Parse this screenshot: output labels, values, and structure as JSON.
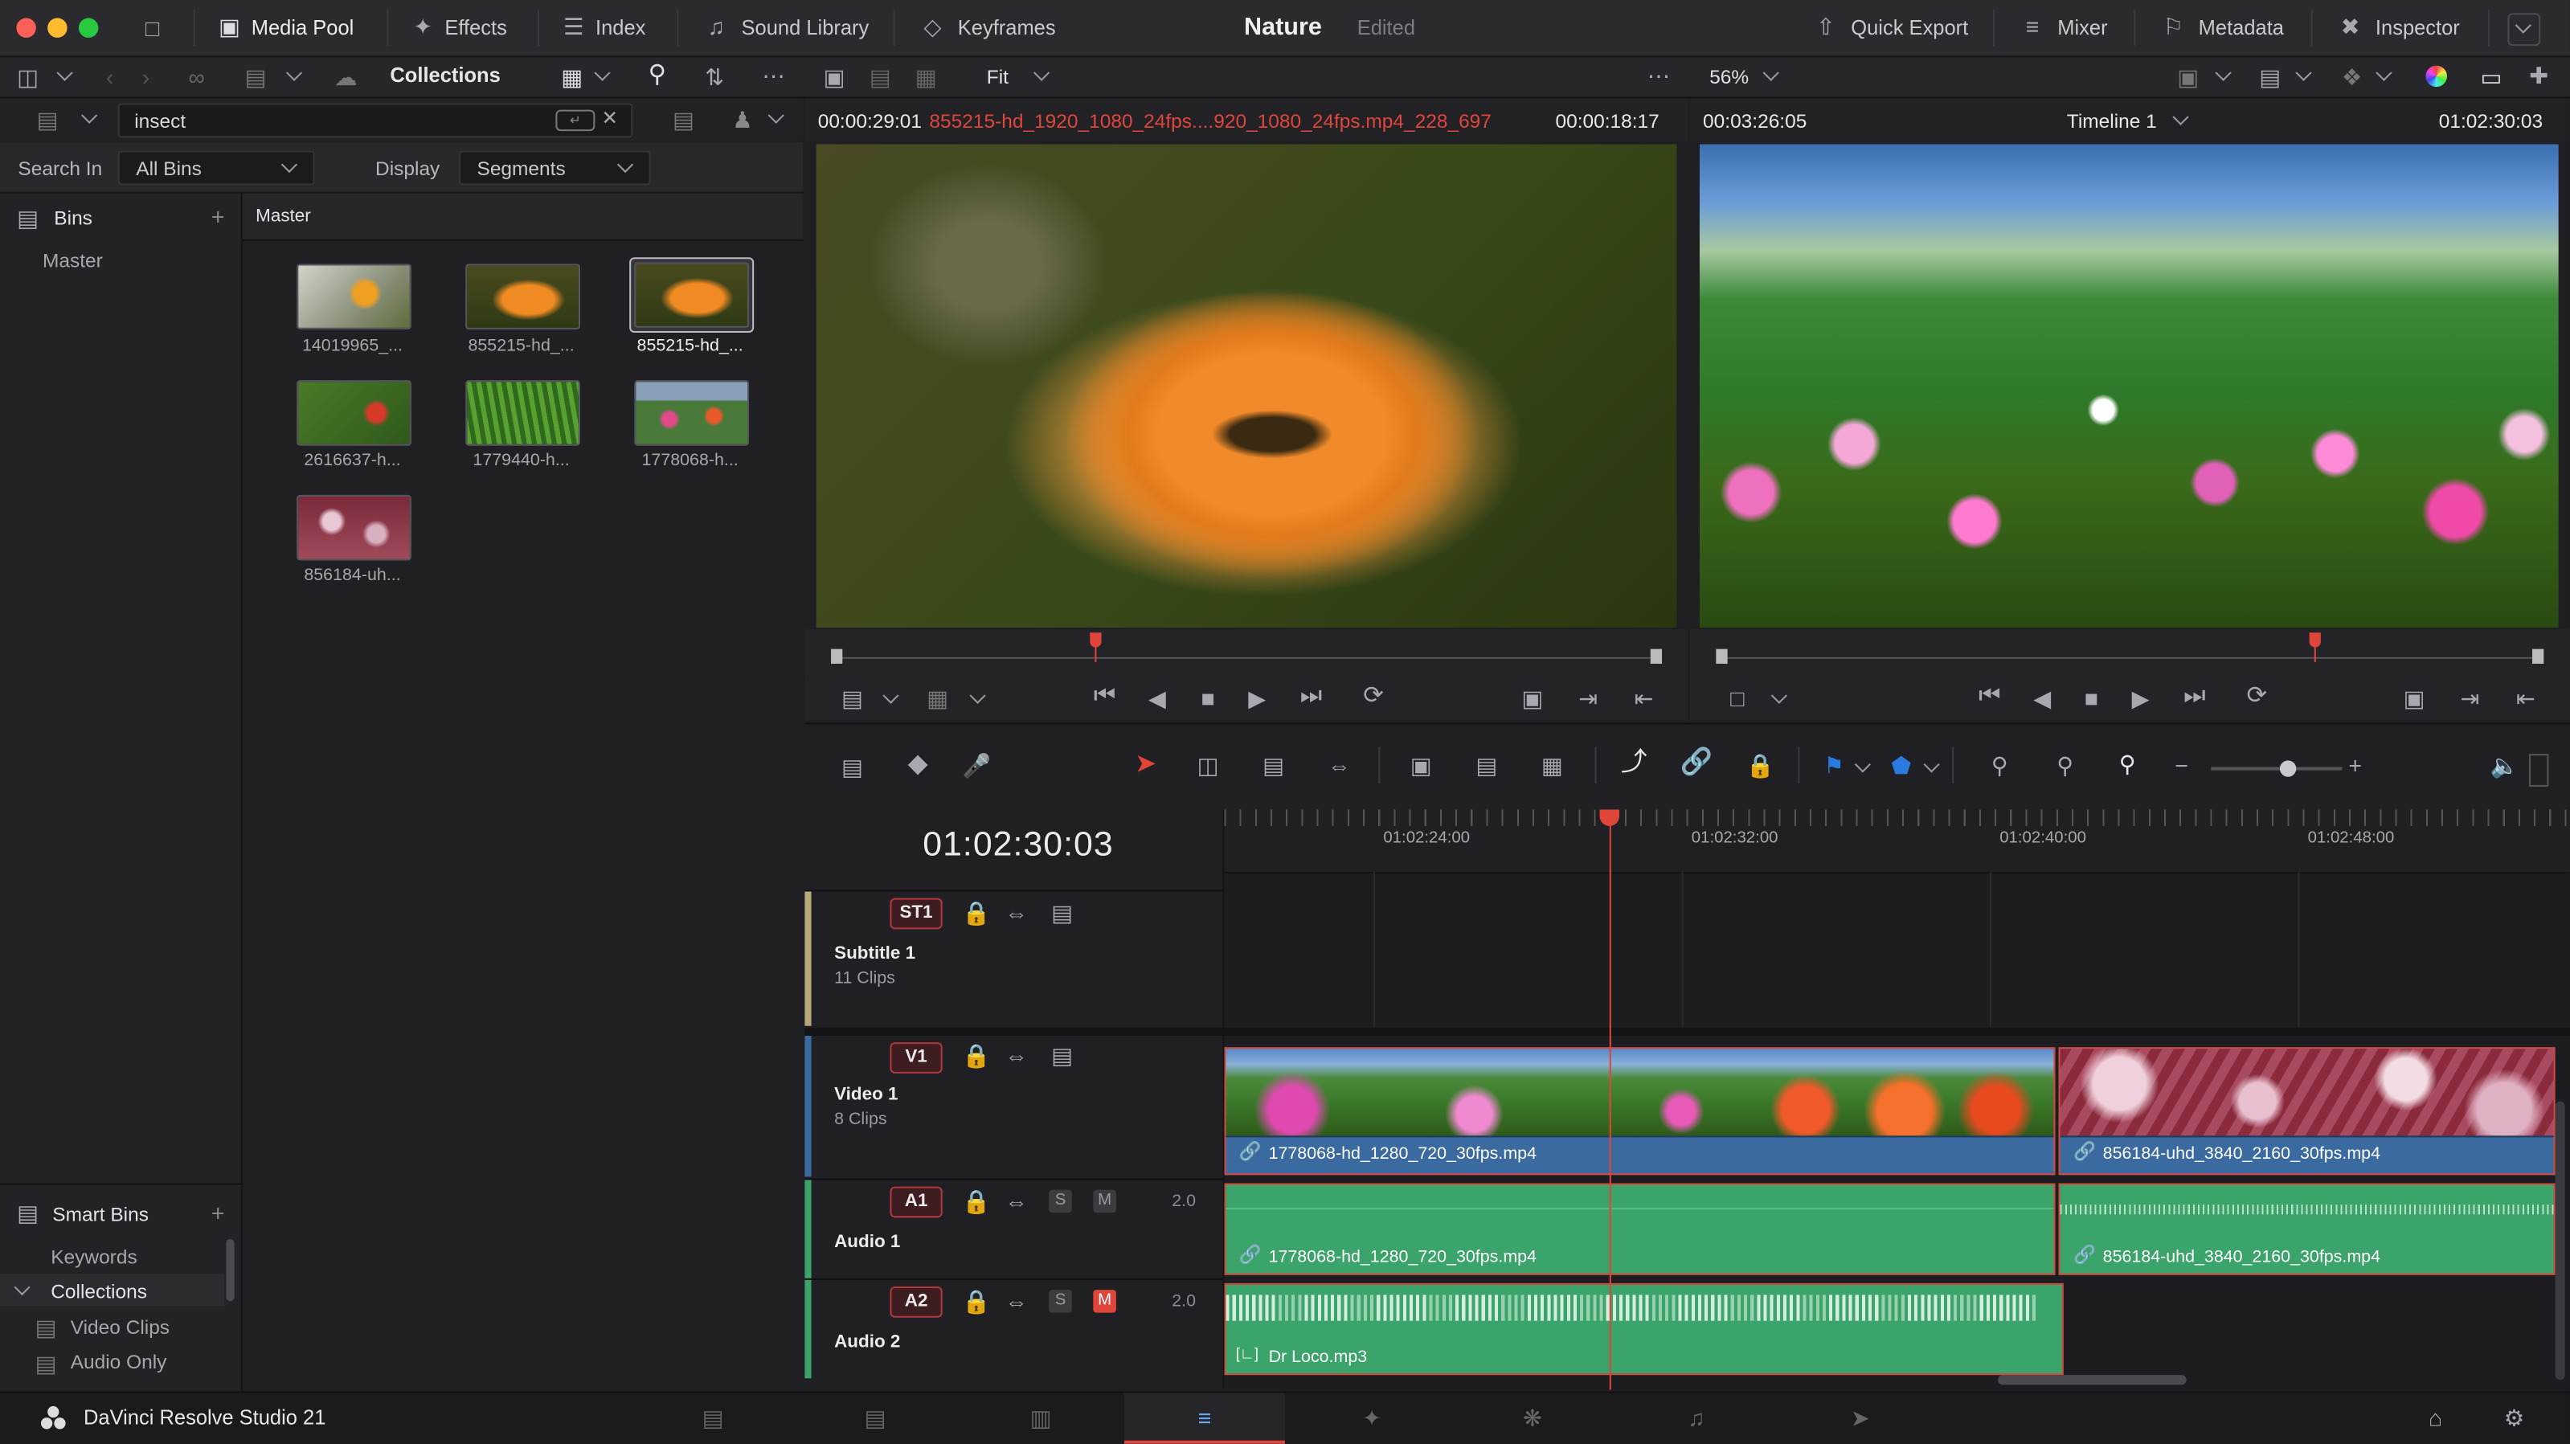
{
  "window": {
    "project": "Nature",
    "status": "Edited"
  },
  "toolbar": {
    "media_pool": "Media Pool",
    "effects": "Effects",
    "index": "Index",
    "sound_library": "Sound Library",
    "keyframes": "Keyframes",
    "quick_export": "Quick Export",
    "mixer": "Mixer",
    "metadata": "Metadata",
    "inspector": "Inspector"
  },
  "subbar": {
    "collections": "Collections",
    "fit": "Fit",
    "zoom": "56%"
  },
  "search": {
    "query": "insect",
    "search_in_label": "Search In",
    "search_in_value": "All Bins",
    "display_label": "Display",
    "display_value": "Segments"
  },
  "bins": {
    "header": "Bins",
    "master": "Master",
    "smart_header": "Smart Bins",
    "keywords": "Keywords",
    "collections": "Collections",
    "video_clips": "Video Clips",
    "audio_only": "Audio Only"
  },
  "pool": {
    "title": "Master",
    "clips": [
      {
        "label": "14019965_..."
      },
      {
        "label": "855215-hd_..."
      },
      {
        "label": "855215-hd_..."
      },
      {
        "label": "2616637-h..."
      },
      {
        "label": "1779440-h..."
      },
      {
        "label": "1778068-h..."
      },
      {
        "label": "856184-uh..."
      }
    ]
  },
  "source": {
    "tc_in": "00:00:29:01",
    "clip": "855215-hd_1920_1080_24fps....920_1080_24fps.mp4_228_697",
    "duration": "00:00:18:17"
  },
  "timeline_view": {
    "tc_left": "00:03:26:05",
    "name": "Timeline 1",
    "tc_right": "01:02:30:03"
  },
  "timeline": {
    "timecode": "01:02:30:03",
    "ruler": [
      "01:02:24:00",
      "01:02:32:00",
      "01:02:40:00",
      "01:02:48:00"
    ],
    "tracks": {
      "st1": {
        "badge": "ST1",
        "name": "Subtitle 1",
        "count": "11 Clips"
      },
      "v1": {
        "badge": "V1",
        "name": "Video 1",
        "count": "8 Clips"
      },
      "a1": {
        "badge": "A1",
        "name": "Audio 1",
        "level": "2.0",
        "s": "S",
        "m": "M"
      },
      "a2": {
        "badge": "A2",
        "name": "Audio 2",
        "level": "2.0",
        "s": "S",
        "m": "M"
      }
    },
    "clips": {
      "v1a": "1778068-hd_1280_720_30fps.mp4",
      "v1b": "856184-uhd_3840_2160_30fps.mp4",
      "a1a": "1778068-hd_1280_720_30fps.mp4",
      "a1b": "856184-uhd_3840_2160_30fps.mp4",
      "a2a": "Dr Loco.mp3"
    }
  },
  "app": {
    "name": "DaVinci Resolve Studio 21"
  },
  "colors": {
    "accent_red": "#e04a3c",
    "video_clip": "#3a6aa0",
    "audio_clip": "#3aa46a",
    "bg": "#1f1f23"
  }
}
